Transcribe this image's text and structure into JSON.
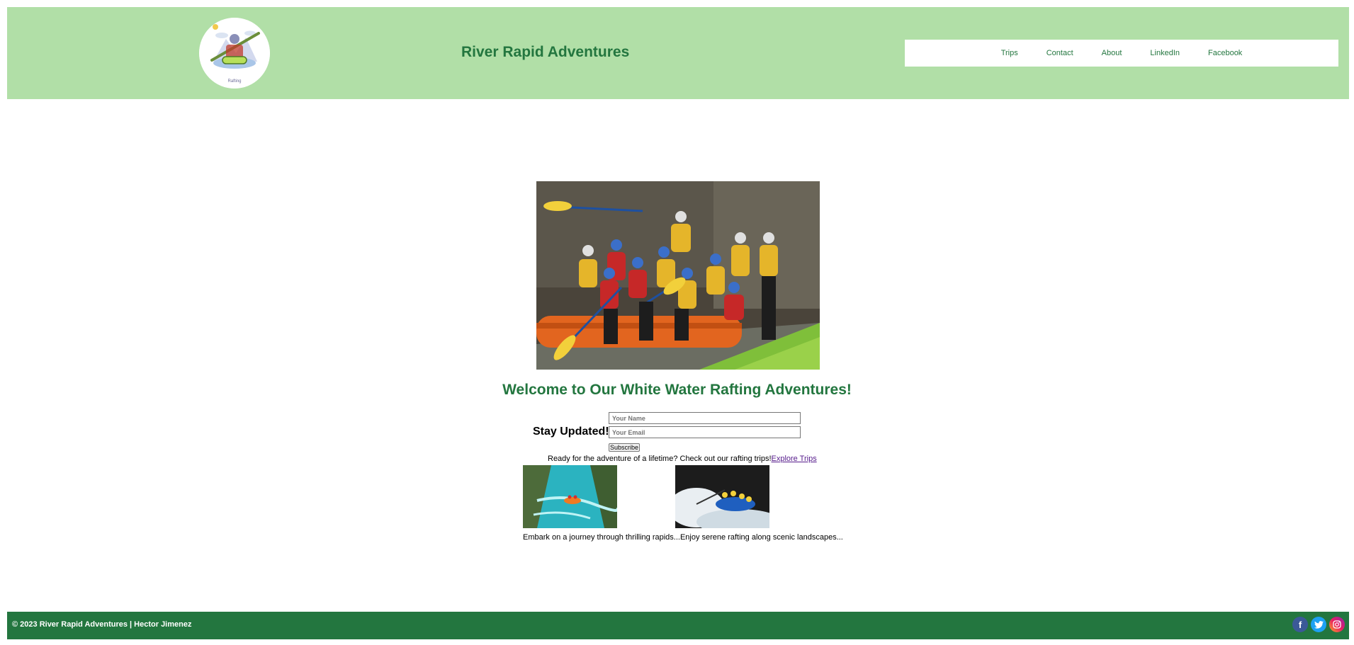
{
  "header": {
    "logo_caption": "Rafting",
    "title": "River Rapid Adventures",
    "nav": [
      "Trips",
      "Contact",
      "About",
      "LinkedIn",
      "Facebook"
    ]
  },
  "main": {
    "welcome": "Welcome to Our White Water Rafting Adventures!",
    "form": {
      "heading": "Stay Updated!",
      "name_placeholder": "Your Name",
      "email_placeholder": "Your Email",
      "subscribe_label": "Subscribe"
    },
    "cta_text": "Ready for the adventure of a lifetime? Check out our rafting trips!",
    "cta_link": "Explore Trips",
    "cards": [
      {
        "caption": "Embark on a journey through thrilling rapids..."
      },
      {
        "caption": "Enjoy serene rafting along scenic landscapes..."
      }
    ]
  },
  "footer": {
    "copyright": "© 2023 River Rapid Adventures | Hector Jimenez",
    "social": [
      "facebook-icon",
      "twitter-icon",
      "instagram-icon"
    ]
  },
  "colors": {
    "header_bg": "#b1dfa7",
    "brand_green": "#23763f",
    "link_visited": "#551a8b"
  }
}
